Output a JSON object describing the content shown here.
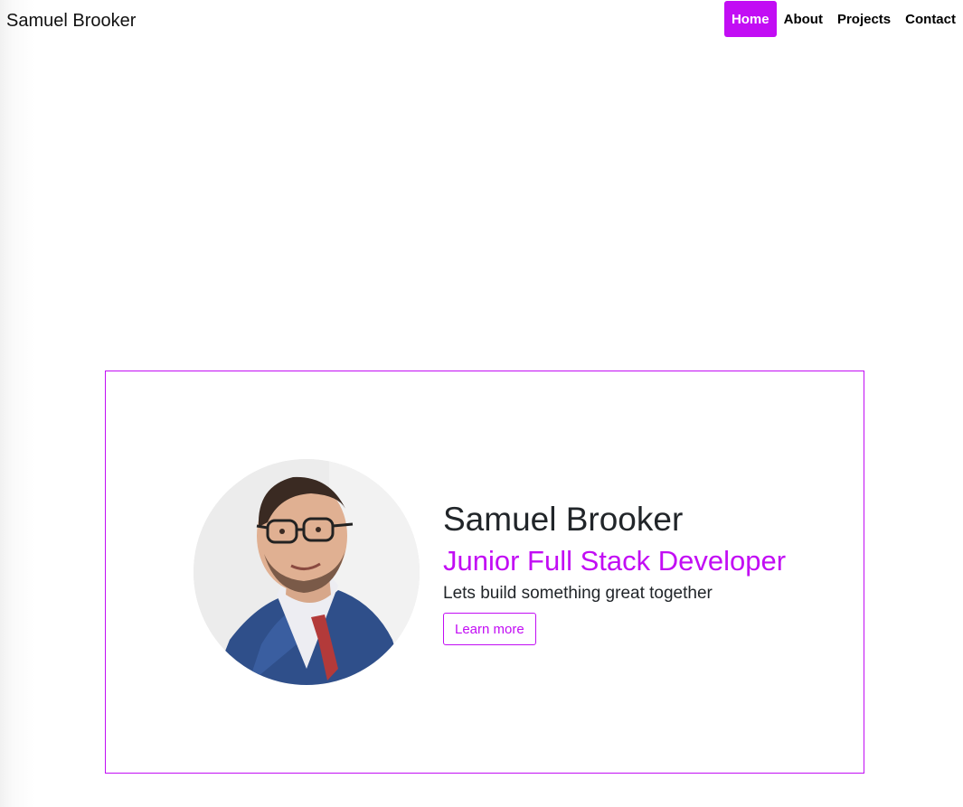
{
  "navbar": {
    "brand": "Samuel Brooker",
    "links": [
      {
        "label": "Home",
        "active": true
      },
      {
        "label": "About",
        "active": false
      },
      {
        "label": "Projects",
        "active": false
      },
      {
        "label": "Contact",
        "active": false
      }
    ]
  },
  "hero": {
    "name": "Samuel Brooker",
    "role": "Junior Full Stack Developer",
    "tagline": "Lets build something great together",
    "cta_label": "Learn more",
    "avatar_icon": "profile-photo"
  },
  "colors": {
    "accent": "#c20df4",
    "text": "#212529",
    "background": "#ffffff"
  }
}
